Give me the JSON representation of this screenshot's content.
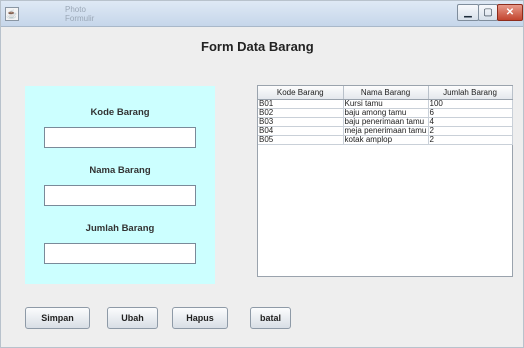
{
  "window": {
    "app_icon": "app-window-icon",
    "ghost_lines": [
      "Photo",
      "Formulir"
    ],
    "controls": {
      "minimize": "minimize-icon",
      "maximize": "maximize-icon",
      "close": "close-icon"
    }
  },
  "form": {
    "title": "Form Data Barang",
    "fields": {
      "kode_label": "Kode Barang",
      "kode_value": "",
      "nama_label": "Nama Barang",
      "nama_value": "",
      "jumlah_label": "Jumlah Barang",
      "jumlah_value": ""
    },
    "panel_color": "#ccffff"
  },
  "table": {
    "columns": [
      "Kode Barang",
      "Nama Barang",
      "Jumlah Barang"
    ],
    "rows": [
      [
        "B01",
        "Kursi tamu",
        "100"
      ],
      [
        "B02",
        "baju among tamu",
        "6"
      ],
      [
        "B03",
        "baju penerimaan tamu",
        "4"
      ],
      [
        "B04",
        "meja penerimaan tamu",
        "2"
      ],
      [
        "B05",
        "kotak amplop",
        "2"
      ]
    ]
  },
  "buttons": {
    "simpan": "Simpan",
    "ubah": "Ubah",
    "hapus": "Hapus",
    "batal": "batal"
  }
}
